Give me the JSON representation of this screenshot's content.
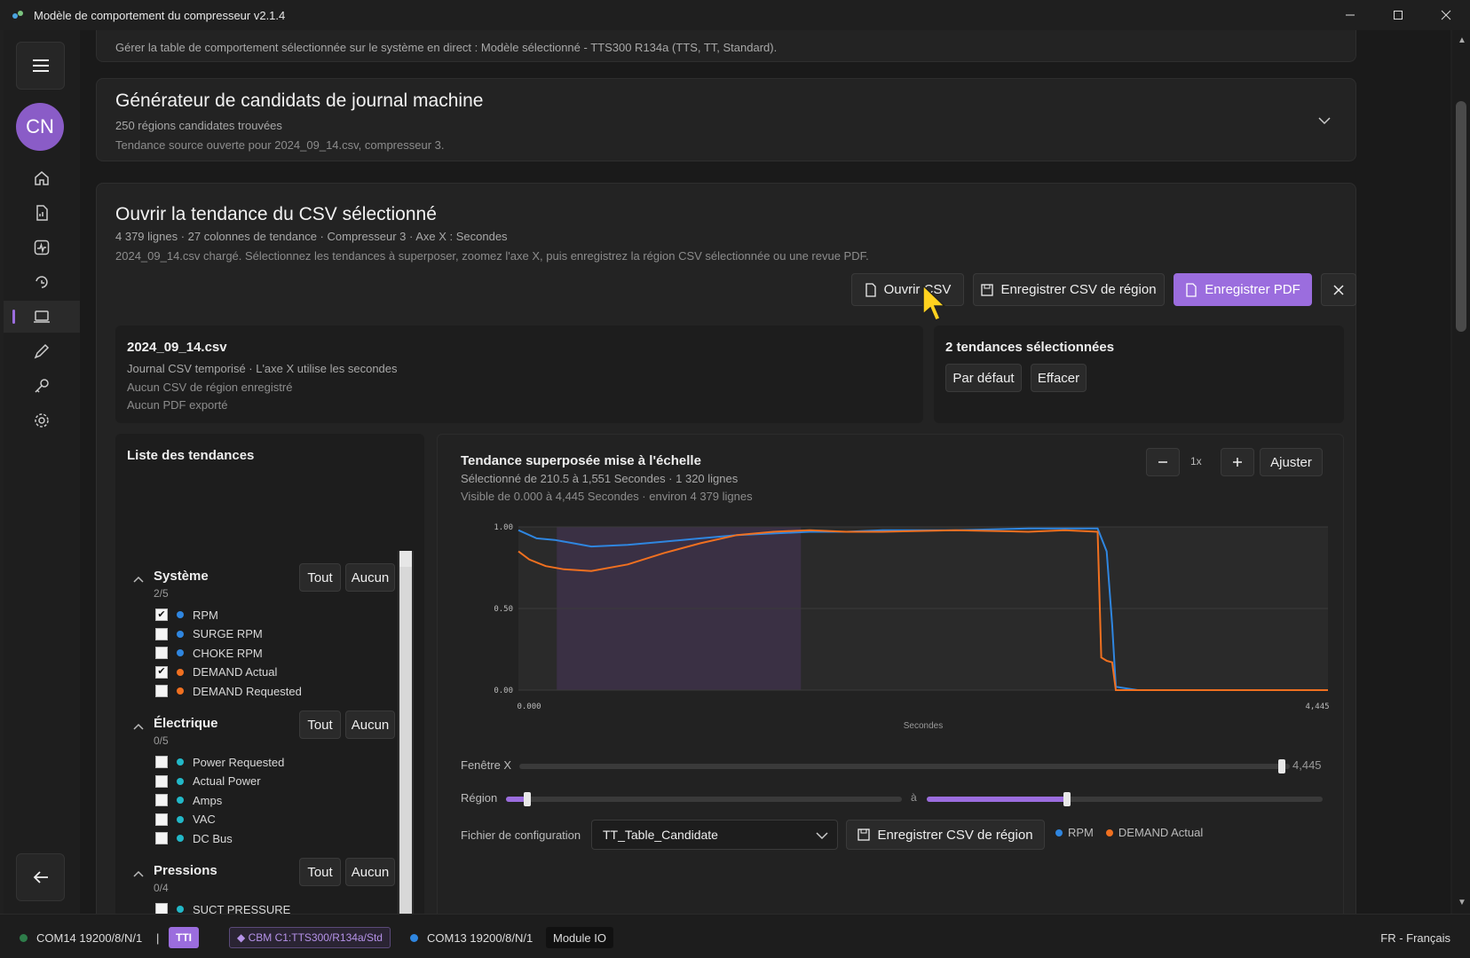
{
  "window": {
    "title": "Modèle de comportement du compresseur v2.1.4",
    "minimize_icon": "minimize-icon",
    "maximize_icon": "maximize-icon",
    "close_icon": "close-icon"
  },
  "sidebar": {
    "avatar_initials": "CN",
    "nav_icons": [
      "home-icon",
      "report-icon",
      "activity-icon",
      "cycle-icon",
      "monitor-icon",
      "pen-icon",
      "key-icon",
      "gear-icon"
    ],
    "active_index": 4,
    "accent": "#9b6dde"
  },
  "top_card": {
    "text": "Gérer la table de comportement sélectionnée sur le système en direct : Modèle sélectionné - TTS300 R134a (TTS, TT, Standard)."
  },
  "generator_card": {
    "title": "Générateur de candidats de journal machine",
    "subtitle": "250 régions candidates trouvées",
    "note": "Tendance source ouverte pour 2024_09_14.csv, compresseur 3."
  },
  "csv_card": {
    "title": "Ouvrir la tendance du CSV sélectionné",
    "meta": "4 379 lignes · 27 colonnes de tendance · Compresseur 3 · Axe X : Secondes",
    "note": "2024_09_14.csv chargé. Sélectionnez les tendances à superposer, zoomez l'axe X, puis enregistrez la région CSV sélectionnée ou une revue PDF.",
    "buttons": {
      "open_csv": "Ouvrir CSV",
      "save_region_csv": "Enregistrer CSV de région",
      "save_pdf": "Enregistrer PDF"
    },
    "file_info": {
      "name": "2024_09_14.csv",
      "desc": "Journal CSV temporisé · L'axe X utilise les secondes",
      "region_status": "Aucun CSV de région enregistré",
      "pdf_status": "Aucun PDF exporté"
    },
    "selection": {
      "title": "2 tendances sélectionnées",
      "default_label": "Par défaut",
      "clear_label": "Effacer"
    }
  },
  "trend_list": {
    "title": "Liste des tendances",
    "all_label": "Tout",
    "none_label": "Aucun",
    "groups": [
      {
        "name": "Système",
        "count": "2/5",
        "items": [
          {
            "label": "RPM",
            "checked": true,
            "color": "#2f86e0"
          },
          {
            "label": "SURGE RPM",
            "checked": false,
            "color": "#2f86e0"
          },
          {
            "label": "CHOKE RPM",
            "checked": false,
            "color": "#2f86e0"
          },
          {
            "label": "DEMAND Actual",
            "checked": true,
            "color": "#f07020"
          },
          {
            "label": "DEMAND Requested",
            "checked": false,
            "color": "#f07020"
          }
        ]
      },
      {
        "name": "Électrique",
        "count": "0/5",
        "items": [
          {
            "label": "Power Requested",
            "checked": false,
            "color": "#22b8c8"
          },
          {
            "label": "Actual Power",
            "checked": false,
            "color": "#22b8c8"
          },
          {
            "label": "Amps",
            "checked": false,
            "color": "#22b8c8"
          },
          {
            "label": "VAC",
            "checked": false,
            "color": "#22b8c8"
          },
          {
            "label": "DC Bus",
            "checked": false,
            "color": "#22b8c8"
          }
        ]
      },
      {
        "name": "Pressions",
        "count": "0/4",
        "items": [
          {
            "label": "SUCT PRESSURE",
            "checked": false,
            "color": "#22b8c8"
          }
        ]
      }
    ]
  },
  "chart_panel": {
    "title": "Tendance superposée mise à l'échelle",
    "selected": "Sélectionné de 210.5 à 1,551 Secondes · 1 320 lignes",
    "visible": "Visible de 0.000 à 4,445 Secondes · environ 4 379 lignes",
    "zoom_label": "1x",
    "fit_label": "Ajuster",
    "xwindow_label": "Fenêtre X",
    "xwindow_value": "4,445",
    "region_label": "Région",
    "region_to": "à",
    "region_start_fraction": 0.05,
    "region_end_fraction": 0.35,
    "config_label": "Fichier de configuration",
    "config_value": "TT_Table_Candidate",
    "save_region_label": "Enregistrer CSV de région",
    "legend": [
      {
        "label": "RPM",
        "color": "#2f86e0"
      },
      {
        "label": "DEMAND Actual",
        "color": "#f07020"
      }
    ]
  },
  "chart_data": {
    "type": "line",
    "title": "",
    "xlabel": "Secondes",
    "ylabel": "",
    "xlim": [
      0,
      4445
    ],
    "ylim": [
      0,
      1
    ],
    "x_tick_labels": [
      "0.000",
      "4,445"
    ],
    "y_tick_labels": [
      "0.00",
      "0.50",
      "1.00"
    ],
    "selected_region": [
      210.5,
      1551
    ],
    "series": [
      {
        "name": "RPM",
        "color": "#2f86e0",
        "x": [
          0,
          100,
          200,
          300,
          400,
          600,
          800,
          1000,
          1200,
          1400,
          1600,
          1800,
          2000,
          2400,
          2800,
          3000,
          3180,
          3230,
          3260,
          3280,
          3400,
          4445
        ],
        "y": [
          0.98,
          0.93,
          0.92,
          0.9,
          0.88,
          0.89,
          0.91,
          0.93,
          0.95,
          0.96,
          0.97,
          0.97,
          0.98,
          0.98,
          0.99,
          0.99,
          0.99,
          0.85,
          0.4,
          0.02,
          0.0,
          0.0
        ]
      },
      {
        "name": "DEMAND Actual",
        "color": "#f07020",
        "x": [
          0,
          60,
          150,
          250,
          400,
          600,
          800,
          1000,
          1200,
          1400,
          1600,
          1800,
          2000,
          2400,
          2800,
          3000,
          3180,
          3200,
          3230,
          3260,
          3280,
          3400,
          4445
        ],
        "y": [
          0.85,
          0.8,
          0.76,
          0.74,
          0.73,
          0.77,
          0.84,
          0.9,
          0.95,
          0.97,
          0.98,
          0.97,
          0.97,
          0.98,
          0.97,
          0.98,
          0.97,
          0.2,
          0.18,
          0.17,
          0.0,
          0.0,
          0.0
        ]
      }
    ],
    "grid": true,
    "legend": "bottom-right"
  },
  "status_bar": {
    "port1": "COM14 19200/8/N/1",
    "sep": "|",
    "tag": "TTI",
    "model_chip": "◆ CBM C1:TTS300/R134a/Std",
    "port2": "COM13 19200/8/N/1",
    "module": "Module IO",
    "language": "FR - Français"
  }
}
